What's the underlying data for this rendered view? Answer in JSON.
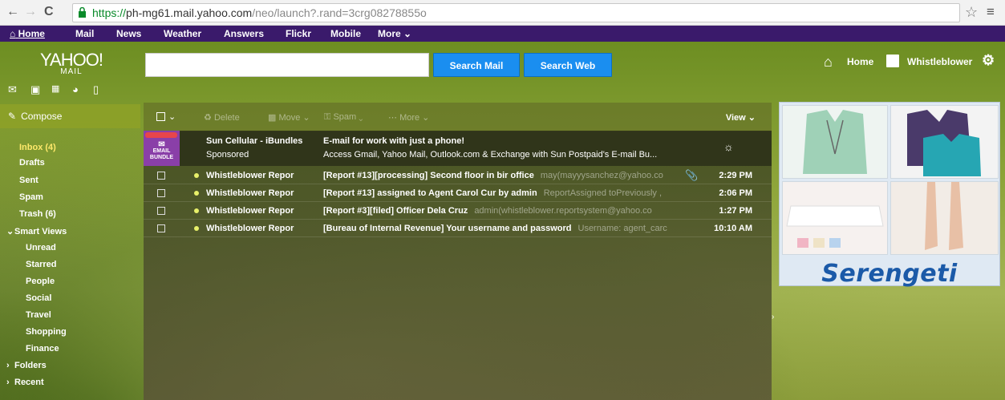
{
  "browser": {
    "url_protocol": "https://",
    "url_host": "ph-mg61.mail.yahoo.com",
    "url_path": "/neo/launch?.rand=3crg08278855o",
    "back_icon": "arrow-left-icon",
    "forward_icon": "arrow-right-icon",
    "reload_icon": "reload-icon"
  },
  "topnav": {
    "home": "Home",
    "mail": "Mail",
    "news": "News",
    "weather": "Weather",
    "answers": "Answers",
    "flickr": "Flickr",
    "mobile": "Mobile",
    "more": "More"
  },
  "header": {
    "logo_main": "YAHOO!",
    "logo_sub": "MAIL",
    "search_placeholder": "",
    "search_mail": "Search Mail",
    "search_web": "Search Web",
    "home": "Home",
    "username": "Whistleblower"
  },
  "sidebar": {
    "compose": "Compose",
    "inbox": "Inbox (4)",
    "drafts": "Drafts",
    "sent": "Sent",
    "spam": "Spam",
    "trash": "Trash (6)",
    "smart_views": "Smart Views",
    "unread": "Unread",
    "starred": "Starred",
    "people": "People",
    "social": "Social",
    "travel": "Travel",
    "shopping": "Shopping",
    "finance": "Finance",
    "folders": "Folders",
    "recent": "Recent"
  },
  "toolbar": {
    "delete": "Delete",
    "move": "Move",
    "spam": "Spam",
    "more": "More",
    "view": "View"
  },
  "sponsored": {
    "from": "Sun Cellular - iBundles",
    "label": "Sponsored",
    "title": "E-mail for work with just a phone!",
    "desc": "Access Gmail, Yahoo Mail, Outlook.com & Exchange with Sun Postpaid's E-mail Bu...",
    "badge_line1": "EMAIL",
    "badge_line2": "BUNDLE"
  },
  "messages": [
    {
      "from": "Whistleblower Repor",
      "subject": "[Report #13][processing] Second floor in bir office",
      "preview": "may(mayyysanchez@yahoo.co",
      "time": "2:29 PM",
      "attachment": true
    },
    {
      "from": "Whistleblower Repor",
      "subject": "[Report #13] assigned to Agent Carol Cur by admin",
      "preview": "ReportAssigned toPreviously ,",
      "time": "2:06 PM",
      "attachment": false
    },
    {
      "from": "Whistleblower Repor",
      "subject": "[Report #3][filed] Officer Dela Cruz",
      "preview": "admin(whistleblower.reportsystem@yahoo.co",
      "time": "1:27 PM",
      "attachment": false
    },
    {
      "from": "Whistleblower Repor",
      "subject": "[Bureau of Internal Revenue] Your username and password",
      "preview": "Username: agent_carc",
      "time": "10:10 AM",
      "attachment": false
    }
  ],
  "ad": {
    "brand": "Serengeti"
  },
  "colors": {
    "topnav_bg": "#3a1a6b",
    "button_blue": "#1a8ef0",
    "unread_dot": "#e8f06a"
  }
}
